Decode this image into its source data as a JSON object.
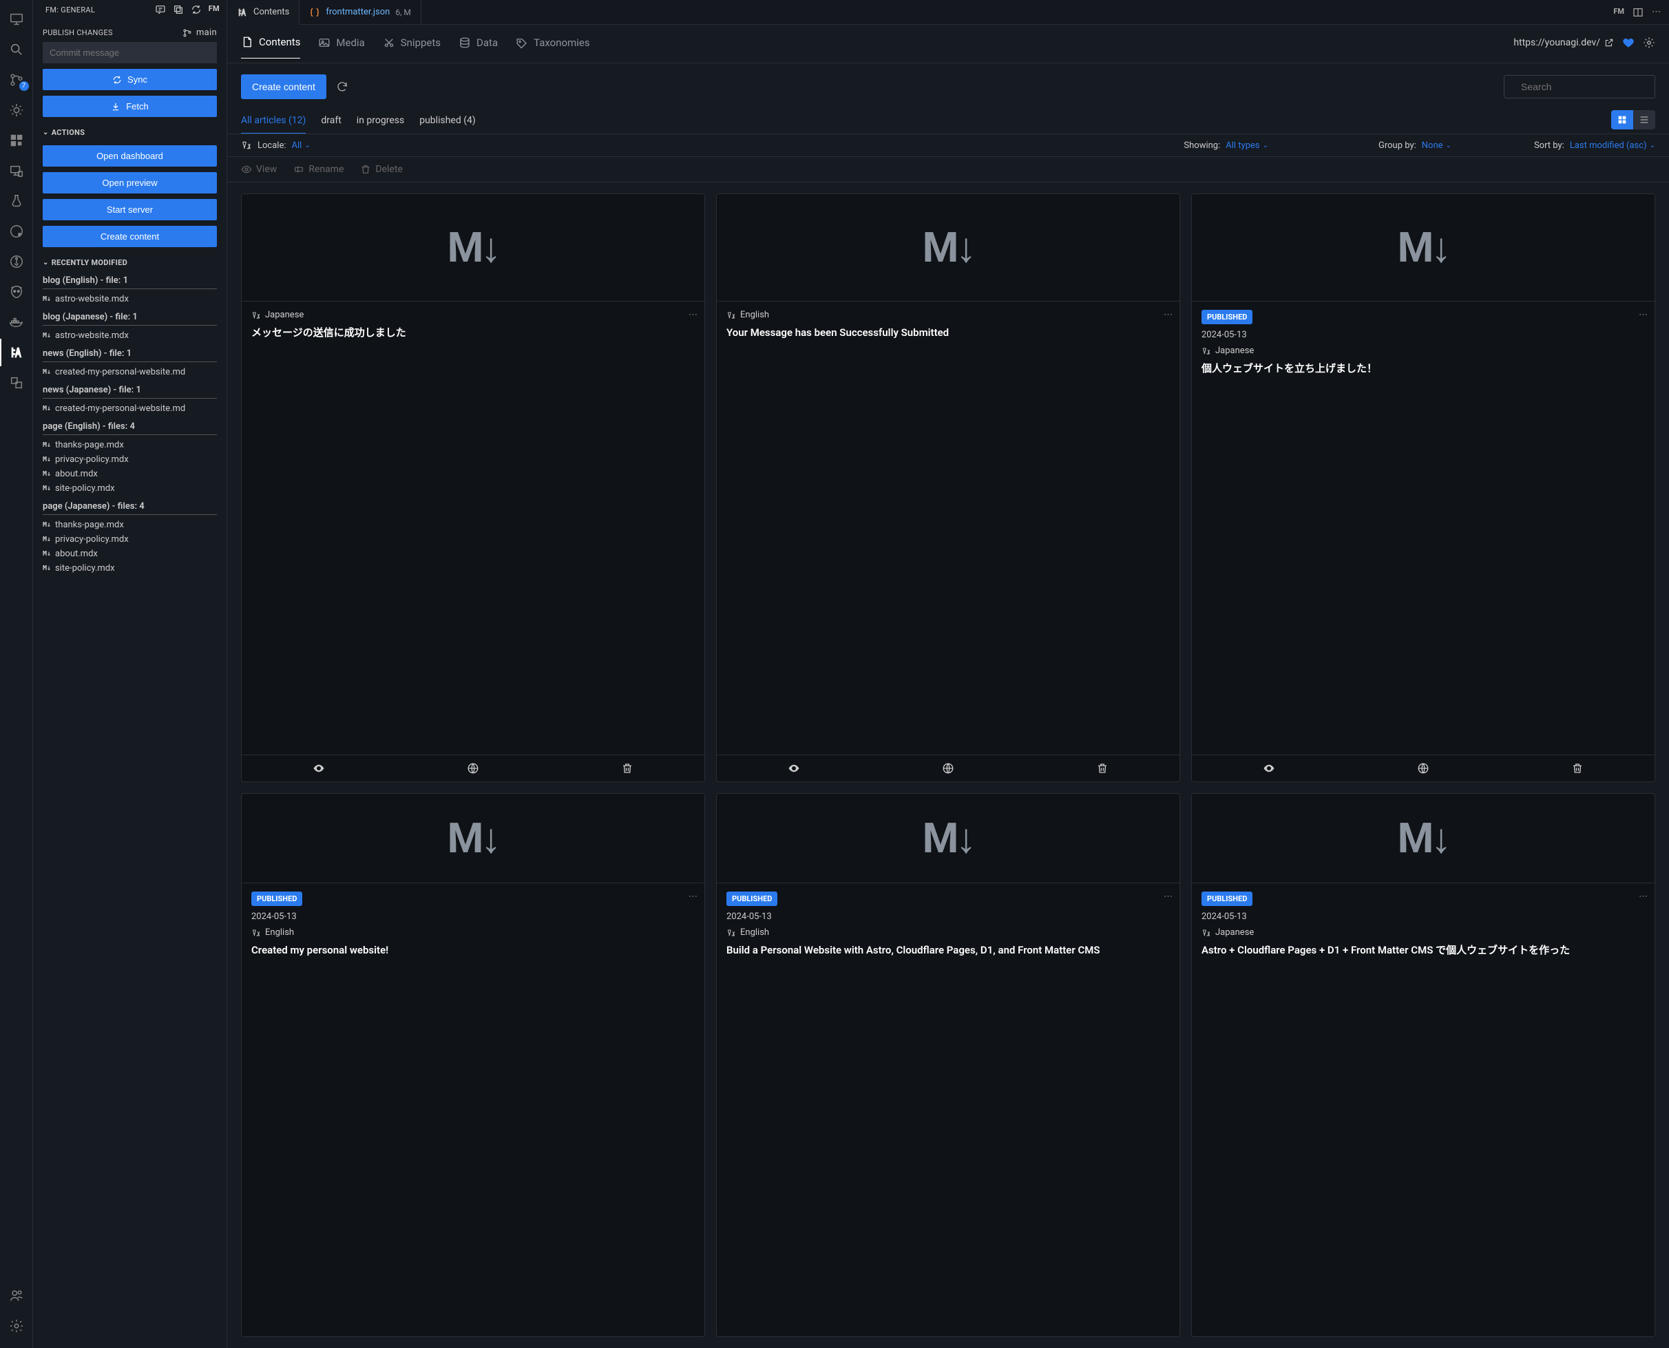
{
  "activityBar": {
    "badgeCount": "7"
  },
  "sidebar": {
    "title": "FM: GENERAL",
    "publishSection": "PUBLISH CHANGES",
    "branch": "main",
    "commitPlaceholder": "Commit message",
    "syncLabel": "Sync",
    "fetchLabel": "Fetch",
    "actionsTitle": "ACTIONS",
    "actions": {
      "dashboard": "Open dashboard",
      "preview": "Open preview",
      "server": "Start server",
      "create": "Create content"
    },
    "recentTitle": "RECENTLY MODIFIED",
    "recentGroups": [
      {
        "title": "blog (English) - file: 1",
        "files": [
          "astro-website.mdx"
        ]
      },
      {
        "title": "blog (Japanese) - file: 1",
        "files": [
          "astro-website.mdx"
        ]
      },
      {
        "title": "news (English) - file: 1",
        "files": [
          "created-my-personal-website.md"
        ]
      },
      {
        "title": "news (Japanese) - file: 1",
        "files": [
          "created-my-personal-website.md"
        ]
      },
      {
        "title": "page (English) - files: 4",
        "files": [
          "thanks-page.mdx",
          "privacy-policy.mdx",
          "about.mdx",
          "site-policy.mdx"
        ]
      },
      {
        "title": "page (Japanese) - files: 4",
        "files": [
          "thanks-page.mdx",
          "privacy-policy.mdx",
          "about.mdx",
          "site-policy.mdx"
        ]
      }
    ]
  },
  "editorTabs": {
    "contents": "Contents",
    "jsonFile": "frontmatter.json",
    "jsonMod": "6, M"
  },
  "toolbar": {
    "contents": "Contents",
    "media": "Media",
    "snippets": "Snippets",
    "data": "Data",
    "taxonomies": "Taxonomies",
    "url": "https://younagi.dev/"
  },
  "contentHeader": {
    "createLabel": "Create content",
    "searchPlaceholder": "Search"
  },
  "filterTabs": {
    "all": "All articles (12)",
    "draft": "draft",
    "inProgress": "in progress",
    "published": "published (4)"
  },
  "filterBar": {
    "localeLabel": "Locale:",
    "localeValue": "All",
    "showingLabel": "Showing:",
    "showingValue": "All types",
    "groupLabel": "Group by:",
    "groupValue": "None",
    "sortLabel": "Sort by:",
    "sortValue": "Last modified (asc)"
  },
  "actionBar": {
    "view": "View",
    "rename": "Rename",
    "delete": "Delete"
  },
  "labels": {
    "published": "PUBLISHED"
  },
  "cards": [
    {
      "lang": "Japanese",
      "title": "メッセージの送信に成功しました"
    },
    {
      "lang": "English",
      "title": "Your Message has been Successfully Submitted"
    },
    {
      "published": true,
      "date": "2024-05-13",
      "lang": "Japanese",
      "title": "個人ウェブサイトを立ち上げました！"
    },
    {
      "published": true,
      "date": "2024-05-13",
      "lang": "English",
      "title": "Created my personal website!"
    },
    {
      "published": true,
      "date": "2024-05-13",
      "lang": "English",
      "title": "Build a Personal Website with Astro, Cloudflare Pages, D1, and Front Matter CMS"
    },
    {
      "published": true,
      "date": "2024-05-13",
      "lang": "Japanese",
      "title": "Astro + Cloudflare Pages + D1 + Front Matter CMS で個人ウェブサイトを作った"
    }
  ]
}
